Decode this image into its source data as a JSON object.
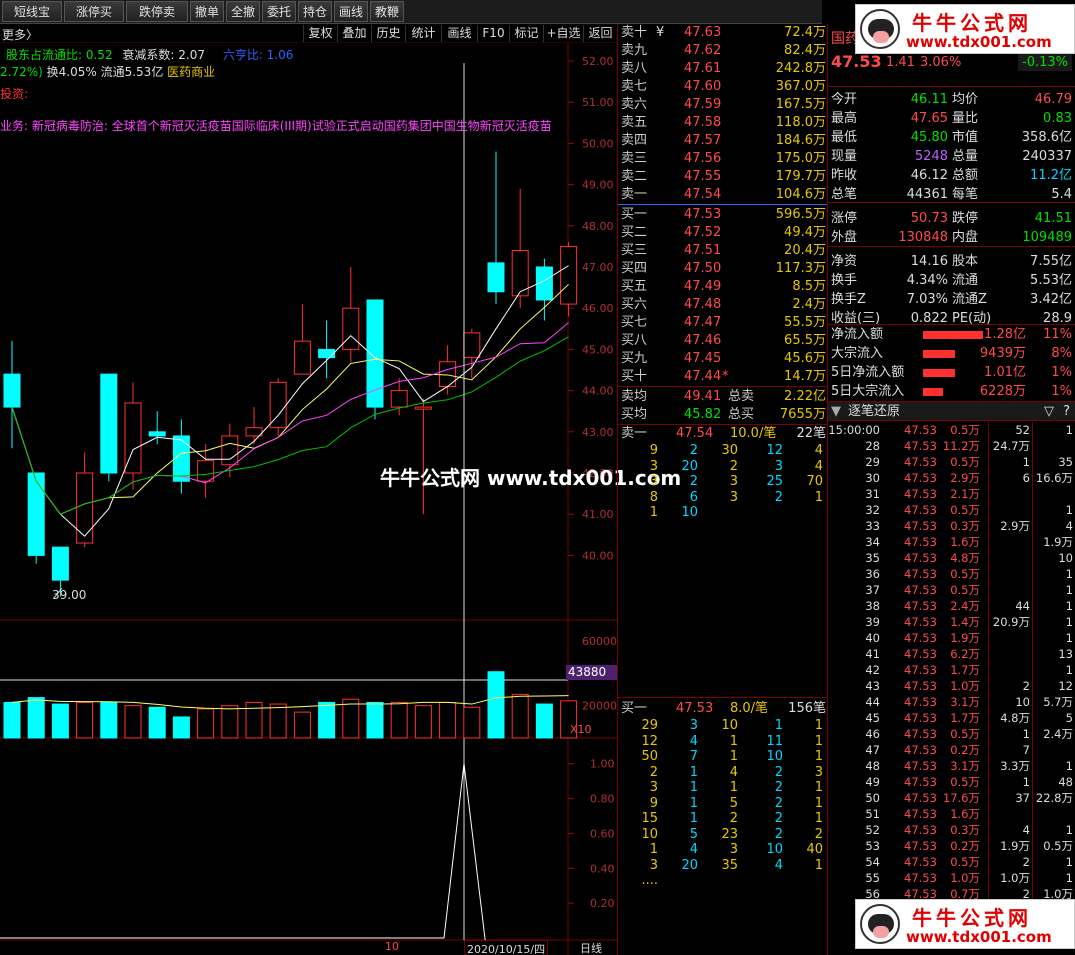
{
  "toolbar": {
    "buttons": [
      "短线宝",
      "涨停买",
      "跌停卖",
      "撤单",
      "全撤",
      "委托",
      "持仓",
      "画线",
      "教鞭"
    ]
  },
  "chart_toolbar": {
    "buttons": [
      "复权",
      "叠加",
      "历史",
      "统计",
      "画线",
      "F10",
      "标记",
      "+自选",
      "返回"
    ]
  },
  "info": {
    "title_fragment": "更多〉",
    "holder_ratio_label": "股东占流通比: 0.52",
    "decay_label": "衰减系数: 2.07",
    "liuxue_label": "六亨比: 1.06",
    "change_fragment": "2.72%)",
    "turnover_label": "换4.05%",
    "float_label": "流通5.53亿",
    "industry": "医药商业",
    "tip_label": "投资:",
    "news": "业务: 新冠病毒防治: 全球首个新冠灭活疫苗国际临床(III期)试验正式启动国药集团中国生物新冠灭活疫苗"
  },
  "chart_data": {
    "type": "candlestick",
    "price_axis": [
      "52.00",
      "51.00",
      "50.00",
      "49.00",
      "48.00",
      "47.00",
      "46.00",
      "45.00",
      "44.00",
      "43.00",
      "42.00",
      "41.00",
      "40.00"
    ],
    "low_marker": "39.00",
    "volume_axis": [
      "60000",
      "40000",
      "20000"
    ],
    "volume_cursor": "43880",
    "volume_multiplier": "X10",
    "indicator_axis": [
      "1.00",
      "0.80",
      "0.60",
      "0.40",
      "0.20"
    ],
    "date_label": "2020/10/15/四",
    "date_left": "10",
    "period_label": "日线",
    "candles": [
      {
        "o": 44.4,
        "c": 43.6,
        "h": 45.2,
        "l": 42.6
      },
      {
        "o": 42.0,
        "c": 40.0,
        "h": 42.0,
        "l": 39.8
      },
      {
        "o": 40.2,
        "c": 39.4,
        "h": 40.2,
        "l": 39.0
      },
      {
        "o": 40.3,
        "c": 42.0,
        "h": 42.5,
        "l": 40.2
      },
      {
        "o": 44.4,
        "c": 42.0,
        "h": 44.4,
        "l": 41.8
      },
      {
        "o": 42.0,
        "c": 43.7,
        "h": 44.2,
        "l": 41.6
      },
      {
        "o": 43.0,
        "c": 42.9,
        "h": 43.5,
        "l": 42.7
      },
      {
        "o": 42.9,
        "c": 41.8,
        "h": 43.3,
        "l": 41.5
      },
      {
        "o": 41.8,
        "c": 42.3,
        "h": 42.7,
        "l": 41.4
      },
      {
        "o": 42.2,
        "c": 42.9,
        "h": 43.2,
        "l": 41.9
      },
      {
        "o": 42.9,
        "c": 43.1,
        "h": 43.6,
        "l": 42.7
      },
      {
        "o": 43.1,
        "c": 44.2,
        "h": 44.3,
        "l": 42.9
      },
      {
        "o": 44.4,
        "c": 45.2,
        "h": 46.1,
        "l": 44.4
      },
      {
        "o": 45.0,
        "c": 44.8,
        "h": 45.7,
        "l": 44.3
      },
      {
        "o": 45.0,
        "c": 46.0,
        "h": 47.0,
        "l": 44.7
      },
      {
        "o": 46.2,
        "c": 43.6,
        "h": 46.2,
        "l": 43.3
      },
      {
        "o": 43.6,
        "c": 44.0,
        "h": 44.3,
        "l": 43.4
      },
      {
        "o": 43.6,
        "c": 43.6,
        "h": 43.8,
        "l": 41.0
      },
      {
        "o": 44.1,
        "c": 44.7,
        "h": 45.1,
        "l": 43.9
      },
      {
        "o": 44.8,
        "c": 45.4,
        "h": 45.5,
        "l": 44.3
      },
      {
        "o": 47.1,
        "c": 46.4,
        "h": 49.8,
        "l": 46.1
      },
      {
        "o": 46.3,
        "c": 47.4,
        "h": 48.9,
        "l": 46.0
      },
      {
        "o": 47.0,
        "c": 46.2,
        "h": 47.2,
        "l": 45.7
      },
      {
        "o": 46.1,
        "c": 47.5,
        "h": 47.6,
        "l": 45.8
      }
    ],
    "volumes": [
      22000,
      25000,
      21000,
      22000,
      22000,
      20000,
      19000,
      13000,
      18000,
      20000,
      22000,
      21000,
      16000,
      22000,
      24000,
      22000,
      22000,
      20000,
      22000,
      19000,
      41000,
      27000,
      21000,
      23000
    ]
  },
  "watermark": {
    "brand": "牛牛公式网",
    "url": "www.tdx001.com",
    "center_text": "牛牛公式网 www.tdx001.com"
  },
  "order_book": {
    "asks": [
      {
        "label": "卖十",
        "price": "47.63",
        "vol": "72.4万",
        "mark": "¥"
      },
      {
        "label": "卖九",
        "price": "47.62",
        "vol": "82.4万"
      },
      {
        "label": "卖八",
        "price": "47.61",
        "vol": "242.8万"
      },
      {
        "label": "卖七",
        "price": "47.60",
        "vol": "367.0万"
      },
      {
        "label": "卖六",
        "price": "47.59",
        "vol": "167.5万"
      },
      {
        "label": "卖五",
        "price": "47.58",
        "vol": "118.0万"
      },
      {
        "label": "卖四",
        "price": "47.57",
        "vol": "184.6万"
      },
      {
        "label": "卖三",
        "price": "47.56",
        "vol": "175.0万"
      },
      {
        "label": "卖二",
        "price": "47.55",
        "vol": "179.7万"
      },
      {
        "label": "卖一",
        "price": "47.54",
        "vol": "104.6万"
      }
    ],
    "bids": [
      {
        "label": "买一",
        "price": "47.53",
        "vol": "596.5万"
      },
      {
        "label": "买二",
        "price": "47.52",
        "vol": "49.4万"
      },
      {
        "label": "买三",
        "price": "47.51",
        "vol": "20.4万"
      },
      {
        "label": "买四",
        "price": "47.50",
        "vol": "117.3万"
      },
      {
        "label": "买五",
        "price": "47.49",
        "vol": "8.5万"
      },
      {
        "label": "买六",
        "price": "47.48",
        "vol": "2.4万"
      },
      {
        "label": "买七",
        "price": "47.47",
        "vol": "55.5万"
      },
      {
        "label": "买八",
        "price": "47.46",
        "vol": "65.5万"
      },
      {
        "label": "买九",
        "price": "47.45",
        "vol": "45.6万"
      },
      {
        "label": "买十",
        "price": "47.44",
        "vol": "14.7万",
        "mark": "*"
      }
    ],
    "avg_sell_label": "卖均",
    "avg_sell": "49.41",
    "total_sell_label": "总卖",
    "total_sell": "2.22亿",
    "avg_buy_label": "买均",
    "avg_buy": "45.82",
    "total_buy_label": "总买",
    "total_buy": "7655万",
    "sell1_header": {
      "label": "卖一",
      "price": "47.54",
      "per": "10.0/笔",
      "count": "22笔"
    },
    "sell1_queue": [
      [
        "9",
        "2",
        "30",
        "12",
        "4"
      ],
      [
        "3",
        "20",
        "2",
        "3",
        "4"
      ],
      [
        "3",
        "2",
        "3",
        "25",
        "70"
      ],
      [
        "8",
        "6",
        "3",
        "2",
        "1"
      ],
      [
        "1",
        "10"
      ]
    ],
    "buy1_header": {
      "label": "买一",
      "price": "47.53",
      "per": "8.0/笔",
      "count": "156笔"
    },
    "buy1_queue": [
      [
        "29",
        "3",
        "10",
        "1",
        "1"
      ],
      [
        "12",
        "4",
        "1",
        "11",
        "1"
      ],
      [
        "50",
        "7",
        "1",
        "10",
        "1"
      ],
      [
        "2",
        "1",
        "4",
        "2",
        "3"
      ],
      [
        "3",
        "1",
        "1",
        "2",
        "1"
      ],
      [
        "9",
        "1",
        "5",
        "2",
        "1"
      ],
      [
        "15",
        "1",
        "2",
        "2",
        "1"
      ],
      [
        "10",
        "5",
        "23",
        "2",
        "2"
      ],
      [
        "1",
        "4",
        "3",
        "10",
        "40"
      ],
      [
        "3",
        "20",
        "35",
        "4",
        "1"
      ],
      [
        "...."
      ]
    ]
  },
  "stock": {
    "name": "国药",
    "price": "47.53",
    "change": "1.41",
    "pct": "3.06%",
    "extra": "-0.13%",
    "stats": [
      [
        "今开",
        "46.11",
        "均价",
        "46.79"
      ],
      [
        "最高",
        "47.65",
        "量比",
        "0.83"
      ],
      [
        "最低",
        "45.80",
        "市值",
        "358.6亿"
      ],
      [
        "现量",
        "5248",
        "总量",
        "240337"
      ],
      [
        "昨收",
        "46.12",
        "总额",
        "11.2亿"
      ],
      [
        "总笔",
        "44361",
        "每笔",
        "5.4"
      ],
      [
        "涨停",
        "50.73",
        "跌停",
        "41.51"
      ],
      [
        "外盘",
        "130848",
        "内盘",
        "109489"
      ],
      [
        "净资",
        "14.16",
        "股本",
        "7.55亿"
      ],
      [
        "换手",
        "4.34%",
        "流通",
        "5.53亿"
      ],
      [
        "换手Z",
        "7.03%",
        "流通Z",
        "3.42亿"
      ],
      [
        "收益(三)",
        "0.822",
        "PE(动)",
        "28.9"
      ]
    ],
    "flows": [
      {
        "label": "净流入额",
        "value": "1.28亿",
        "pct": "11%"
      },
      {
        "label": "大宗流入",
        "value": "9439万",
        "pct": "8%"
      },
      {
        "label": "5日净流入额",
        "value": "1.01亿",
        "pct": "1%"
      },
      {
        "label": "5日大宗流入",
        "value": "6228万",
        "pct": "1%"
      }
    ],
    "ticks_title": "逐笔还原",
    "ticks": [
      [
        "15:00:00",
        "47.53",
        "0.5万",
        "52",
        "1"
      ],
      [
        "28",
        "47.53",
        "11.2万",
        "24.7万",
        ""
      ],
      [
        "29",
        "47.53",
        "0.5万",
        "1",
        "35"
      ],
      [
        "30",
        "47.53",
        "2.9万",
        "6",
        "16.6万"
      ],
      [
        "31",
        "47.53",
        "2.1万",
        "",
        ""
      ],
      [
        "32",
        "47.53",
        "0.5万",
        "",
        "1"
      ],
      [
        "33",
        "47.53",
        "0.3万",
        "2.9万",
        "4"
      ],
      [
        "34",
        "47.53",
        "1.6万",
        "",
        "1.9万"
      ],
      [
        "35",
        "47.53",
        "4.8万",
        "",
        "10"
      ],
      [
        "36",
        "47.53",
        "0.5万",
        "",
        "1"
      ],
      [
        "37",
        "47.53",
        "0.5万",
        "",
        "1"
      ],
      [
        "38",
        "47.53",
        "2.4万",
        "44",
        "1"
      ],
      [
        "39",
        "47.53",
        "1.4万",
        "20.9万",
        "1"
      ],
      [
        "40",
        "47.53",
        "1.9万",
        "",
        "1"
      ],
      [
        "41",
        "47.53",
        "6.2万",
        "",
        "13"
      ],
      [
        "42",
        "47.53",
        "1.7万",
        "",
        "1"
      ],
      [
        "43",
        "47.53",
        "1.0万",
        "2",
        "12"
      ],
      [
        "44",
        "47.53",
        "3.1万",
        "10",
        "5.7万"
      ],
      [
        "45",
        "47.53",
        "1.7万",
        "4.8万",
        "5"
      ],
      [
        "46",
        "47.53",
        "0.5万",
        "1",
        "2.4万"
      ],
      [
        "47",
        "47.53",
        "0.2万",
        "7",
        ""
      ],
      [
        "48",
        "47.53",
        "3.1万",
        "3.3万",
        "1"
      ],
      [
        "49",
        "47.53",
        "0.5万",
        "1",
        "48"
      ],
      [
        "50",
        "47.53",
        "17.6万",
        "37",
        "22.8万"
      ],
      [
        "51",
        "47.53",
        "1.6万",
        "",
        ""
      ],
      [
        "52",
        "47.53",
        "0.3万",
        "4",
        "1"
      ],
      [
        "53",
        "47.53",
        "0.2万",
        "1.9万",
        "0.5万"
      ],
      [
        "54",
        "47.53",
        "0.5万",
        "2",
        "1"
      ],
      [
        "55",
        "47.53",
        "1.0万",
        "1.0万",
        "1"
      ],
      [
        "56",
        "47.53",
        "0.7万",
        "2",
        "1.0万"
      ]
    ]
  }
}
